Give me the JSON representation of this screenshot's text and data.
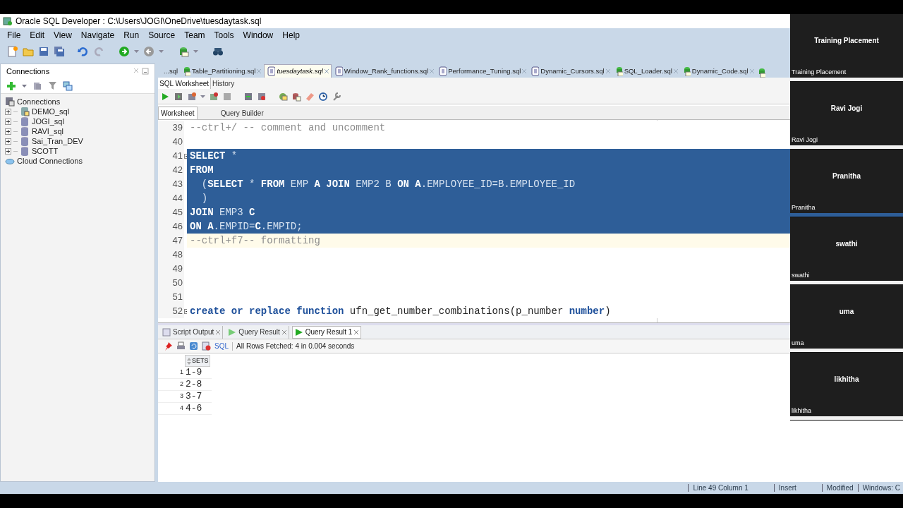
{
  "window": {
    "title": "Oracle SQL Developer : C:\\Users\\JOGI\\OneDrive\\tuesdaytask.sql"
  },
  "menu": [
    "File",
    "Edit",
    "View",
    "Navigate",
    "Run",
    "Source",
    "Team",
    "Tools",
    "Window",
    "Help"
  ],
  "connections_panel": {
    "title": "Connections",
    "tree": [
      {
        "label": "Connections",
        "kind": "root",
        "children": [
          {
            "label": "DEMO_sql",
            "kind": "connection"
          },
          {
            "label": "JOGI_sql",
            "kind": "db"
          },
          {
            "label": "RAVI_sql",
            "kind": "db"
          },
          {
            "label": "Sai_Tran_DEV",
            "kind": "db"
          },
          {
            "label": "SCOTT",
            "kind": "db"
          }
        ]
      },
      {
        "label": "Cloud Connections",
        "kind": "cloud"
      }
    ]
  },
  "editor_tabs": [
    {
      "label": "...sql",
      "kind": "partial",
      "selected": false
    },
    {
      "label": "Table_Partitioning.sql",
      "kind": "script",
      "selected": false
    },
    {
      "label": "tuesdaytask.sql",
      "kind": "worksheet",
      "selected": true
    },
    {
      "label": "Window_Rank_functions.sql",
      "kind": "worksheet",
      "selected": false
    },
    {
      "label": "Performance_Tuning.sql",
      "kind": "worksheet",
      "selected": false
    },
    {
      "label": "Dynamic_Cursors.sql",
      "kind": "worksheet",
      "selected": false
    },
    {
      "label": "SQL_Loader.sql",
      "kind": "script",
      "selected": false
    },
    {
      "label": "Dynamic_Code.sql",
      "kind": "script",
      "selected": false
    }
  ],
  "worksheet_tabs": [
    {
      "label": "SQL Worksheet",
      "selected": true
    },
    {
      "label": "History",
      "selected": false
    }
  ],
  "view_tabs": [
    {
      "label": "Worksheet",
      "selected": true
    },
    {
      "label": "Query Builder",
      "selected": false
    }
  ],
  "code_lines": [
    {
      "number": "39",
      "selected": false,
      "current": false,
      "fold": false,
      "tokens": [
        {
          "kind": "comment",
          "text": "--ctrl+/ -- comment and uncomment"
        }
      ]
    },
    {
      "number": "40",
      "selected": false,
      "current": false,
      "fold": false
    },
    {
      "number": "41",
      "selected": true,
      "current": false,
      "fold": true,
      "tokens": [
        {
          "kind": "keyword",
          "text": "SELECT"
        },
        {
          "kind": "plain",
          "text": " *"
        }
      ]
    },
    {
      "number": "42",
      "selected": true,
      "current": false,
      "fold": false,
      "tokens": [
        {
          "kind": "keyword",
          "text": "FROM"
        }
      ]
    },
    {
      "number": "43",
      "selected": true,
      "current": false,
      "fold": false,
      "tokens": [
        {
          "kind": "plain",
          "text": "  ("
        },
        {
          "kind": "keyword",
          "text": "SELECT"
        },
        {
          "kind": "plain",
          "text": " * "
        },
        {
          "kind": "keyword",
          "text": "FROM"
        },
        {
          "kind": "plain",
          "text": " EMP "
        },
        {
          "kind": "keyword",
          "text": "A JOIN"
        },
        {
          "kind": "plain",
          "text": " EMP2 B "
        },
        {
          "kind": "keyword",
          "text": "ON A"
        },
        {
          "kind": "plain",
          "text": ".EMPLOYEE_ID=B.EMPLOYEE_ID"
        }
      ]
    },
    {
      "number": "44",
      "selected": true,
      "current": false,
      "fold": false,
      "tokens": [
        {
          "kind": "plain",
          "text": "  )"
        }
      ]
    },
    {
      "number": "45",
      "selected": true,
      "current": false,
      "fold": false,
      "tokens": [
        {
          "kind": "keyword",
          "text": "JOIN"
        },
        {
          "kind": "plain",
          "text": " EMP3 "
        },
        {
          "kind": "keyword",
          "text": "C"
        }
      ]
    },
    {
      "number": "46",
      "selected": true,
      "current": false,
      "fold": false,
      "tokens": [
        {
          "kind": "keyword",
          "text": "ON A"
        },
        {
          "kind": "plain",
          "text": ".EMPID="
        },
        {
          "kind": "keyword",
          "text": "C"
        },
        {
          "kind": "plain",
          "text": ".EMPID;"
        }
      ]
    },
    {
      "number": "47",
      "selected": false,
      "current": true,
      "fold": false,
      "tokens": [
        {
          "kind": "comment",
          "text": "--ctrl+f7-- formatting"
        }
      ]
    },
    {
      "number": "48",
      "selected": false,
      "current": false,
      "fold": false
    },
    {
      "number": "49",
      "selected": false,
      "current": false,
      "fold": false
    },
    {
      "number": "50",
      "selected": false,
      "current": false,
      "fold": false
    },
    {
      "number": "51",
      "selected": false,
      "current": false,
      "fold": false
    },
    {
      "number": "52",
      "selected": false,
      "current": false,
      "fold": true,
      "tokens": [
        {
          "kind": "keyword",
          "text": "create or replace function"
        },
        {
          "kind": "plain",
          "text": " ufn_get_number_combinations(p_number "
        },
        {
          "kind": "keyword",
          "text": "number"
        },
        {
          "kind": "plain",
          "text": ")"
        }
      ]
    }
  ],
  "result_tabs": [
    {
      "label": "Script Output",
      "kind": "script",
      "selected": false
    },
    {
      "label": "Query Result",
      "kind": "query",
      "selected": false
    },
    {
      "label": "Query Result 1",
      "kind": "query",
      "selected": true
    }
  ],
  "result_toolbar": {
    "sql_label": "SQL",
    "message": "All Rows Fetched: 4 in 0.004 seconds"
  },
  "result_grid": {
    "columns": [
      "SETS"
    ],
    "rows": [
      {
        "number": "1",
        "cells": [
          "1-9"
        ]
      },
      {
        "number": "2",
        "cells": [
          "2-8"
        ]
      },
      {
        "number": "3",
        "cells": [
          "3-7"
        ]
      },
      {
        "number": "4",
        "cells": [
          "4-6"
        ]
      }
    ]
  },
  "participants": [
    {
      "name": "Training Placement",
      "label": "Training Placement",
      "speaking": false
    },
    {
      "name": "Ravi Jogi",
      "label": "Ravi Jogi",
      "speaking": false
    },
    {
      "name": "Pranitha",
      "label": "Pranitha",
      "speaking": true
    },
    {
      "name": "swathi",
      "label": "swathi",
      "speaking": false
    },
    {
      "name": "uma",
      "label": "uma",
      "speaking": false
    },
    {
      "name": "likhitha",
      "label": "likhitha",
      "speaking": false
    }
  ],
  "status_bar": [
    "Line 49 Column 1",
    "Insert",
    "Modified",
    "Windows: C"
  ]
}
